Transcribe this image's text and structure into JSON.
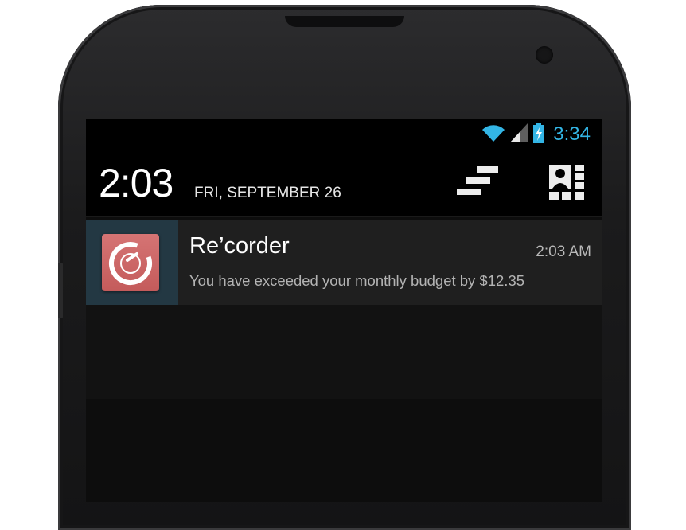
{
  "status_bar": {
    "clock": "3:34",
    "icons": [
      "wifi-icon",
      "cell-signal-icon",
      "battery-charging-icon"
    ]
  },
  "header": {
    "time": "2:03",
    "date": "FRI, SEPTEMBER 26",
    "buttons": [
      "clear-all-icon",
      "quick-settings-icon"
    ]
  },
  "notification": {
    "app_icon": "recorder-app-icon",
    "title": "Re’corder",
    "time": "2:03 AM",
    "text": "You have exceeded your monthly budget by $12.35"
  },
  "colors": {
    "accent": "#33b5e5",
    "notification_icon_bg": "#233843",
    "app_icon": "#d06868"
  }
}
